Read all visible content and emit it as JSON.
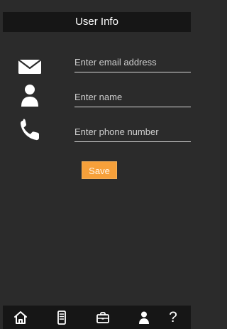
{
  "header": {
    "title": "User Info"
  },
  "form": {
    "fields": [
      {
        "icon": "envelope-icon",
        "placeholder": "Enter email address",
        "value": ""
      },
      {
        "icon": "person-icon",
        "placeholder": "Enter name",
        "value": ""
      },
      {
        "icon": "phone-icon",
        "placeholder": "Enter phone number",
        "value": ""
      }
    ],
    "save_label": "Save"
  },
  "bottom_nav": {
    "items": [
      {
        "icon": "home-icon"
      },
      {
        "icon": "document-icon"
      },
      {
        "icon": "briefcase-icon"
      },
      {
        "icon": "profile-icon"
      },
      {
        "icon": "help-icon",
        "label": "?"
      }
    ]
  },
  "colors": {
    "background": "#2b2b2b",
    "header_background": "#161616",
    "accent": "#f6a03a",
    "text": "#ffffff",
    "underline": "#d7d7d7"
  }
}
